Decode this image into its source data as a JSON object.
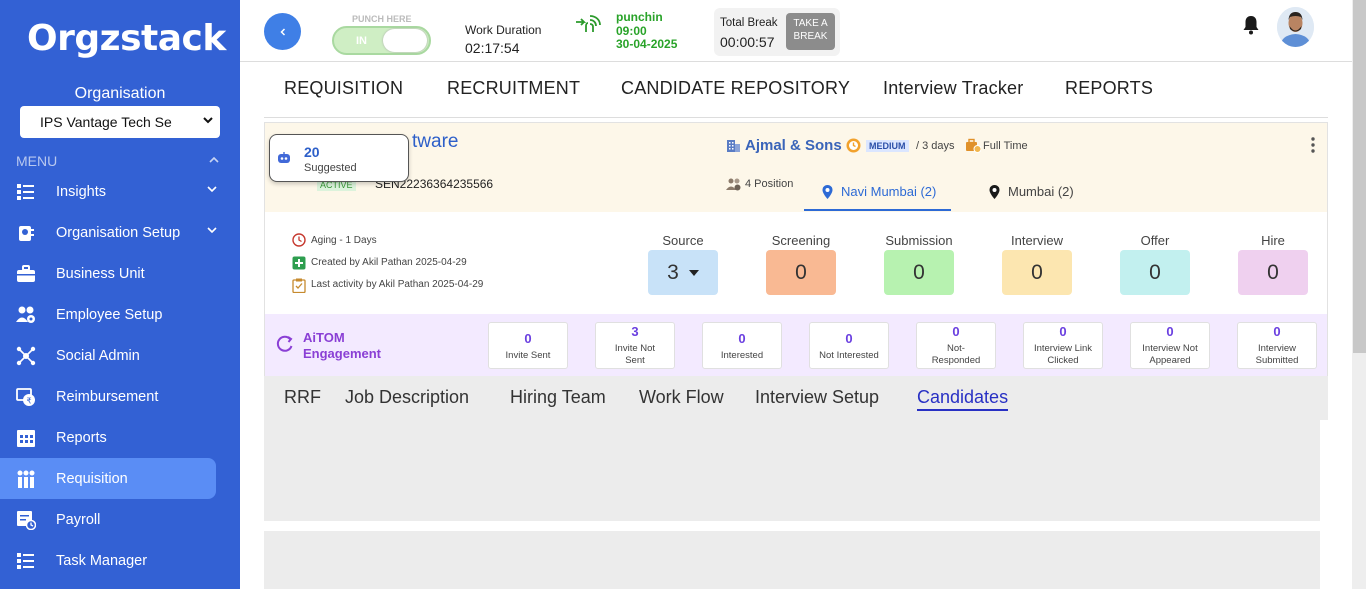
{
  "sidebar": {
    "logo": "Orgzstack",
    "org_label": "Organisation",
    "org_value": "IPS Vantage Tech Se",
    "menu_label": "MENU",
    "items": [
      {
        "label": "Insights",
        "icon": "insights-icon",
        "dropdown": true
      },
      {
        "label": "Organisation Setup",
        "icon": "org-setup-icon",
        "dropdown": true
      },
      {
        "label": "Business Unit",
        "icon": "briefcase-icon",
        "dropdown": false
      },
      {
        "label": "Employee Setup",
        "icon": "employee-icon",
        "dropdown": false
      },
      {
        "label": "Social Admin",
        "icon": "social-icon",
        "dropdown": false
      },
      {
        "label": "Reimbursement",
        "icon": "reimbursement-icon",
        "dropdown": false
      },
      {
        "label": "Reports",
        "icon": "reports-icon",
        "dropdown": false
      },
      {
        "label": "Requisition",
        "icon": "requisition-icon",
        "dropdown": false,
        "active": true
      },
      {
        "label": "Payroll",
        "icon": "payroll-icon",
        "dropdown": false
      },
      {
        "label": "Task Manager",
        "icon": "task-icon",
        "dropdown": false
      }
    ]
  },
  "topbar": {
    "punch_title": "PUNCH HERE",
    "punch_state": "IN",
    "work_duration_label": "Work Duration",
    "work_duration_value": "02:17:54",
    "punch_status": "punchin",
    "punch_time": "09:00",
    "punch_date": "30-04-2025",
    "break_label": "Total Break",
    "break_value": "00:00:57",
    "take_break_line1": "TAKE A",
    "take_break_line2": "BREAK"
  },
  "main_tabs": [
    "REQUISITION",
    "RECRUITMENT",
    "CANDIDATE REPOSITORY",
    "Interview Tracker",
    "REPORTS"
  ],
  "job": {
    "title_fragment": "tware",
    "status": "ACTIVE",
    "id_fragment": "SEN22236364235566",
    "suggested_count": "20",
    "suggested_label": "Suggested",
    "company": "Ajmal & Sons",
    "priority": "MEDIUM",
    "duration": "/ 3 days",
    "employment_type": "Full Time",
    "positions": "4 Position",
    "locations": [
      {
        "label": "Navi Mumbai (2)",
        "selected": true
      },
      {
        "label": "Mumbai (2)",
        "selected": false
      }
    ],
    "aging": "Aging - 1 Days",
    "created_by": "Created by Akil Pathan 2025-04-29",
    "last_activity": "Last activity by Akil Pathan 2025-04-29"
  },
  "pipeline": [
    {
      "label": "Source",
      "value": "3",
      "color": "#c8e2f8"
    },
    {
      "label": "Screening",
      "value": "0",
      "color": "#f9b993"
    },
    {
      "label": "Submission",
      "value": "0",
      "color": "#b7f2b0"
    },
    {
      "label": "Interview",
      "value": "0",
      "color": "#fce6b0"
    },
    {
      "label": "Offer",
      "value": "0",
      "color": "#c2f0ef"
    },
    {
      "label": "Hire",
      "value": "0",
      "color": "#efd0ef"
    }
  ],
  "aitom": {
    "title_line1": "AiTOM",
    "title_line2": "Engagement",
    "stats": [
      {
        "value": "0",
        "label1": "Invite Sent",
        "label2": ""
      },
      {
        "value": "3",
        "label1": "Invite Not",
        "label2": "Sent"
      },
      {
        "value": "0",
        "label1": "Interested",
        "label2": ""
      },
      {
        "value": "0",
        "label1": "Not Interested",
        "label2": ""
      },
      {
        "value": "0",
        "label1": "Not-",
        "label2": "Responded"
      },
      {
        "value": "0",
        "label1": "Interview Link",
        "label2": "Clicked"
      },
      {
        "value": "0",
        "label1": "Interview Not",
        "label2": "Appeared"
      },
      {
        "value": "0",
        "label1": "Interview",
        "label2": "Submitted"
      }
    ]
  },
  "sub_tabs": [
    {
      "label": "RRF",
      "selected": false
    },
    {
      "label": "Job Description",
      "selected": false
    },
    {
      "label": "Hiring Team",
      "selected": false
    },
    {
      "label": "Work Flow",
      "selected": false
    },
    {
      "label": "Interview Setup",
      "selected": false
    },
    {
      "label": "Candidates",
      "selected": true
    }
  ]
}
